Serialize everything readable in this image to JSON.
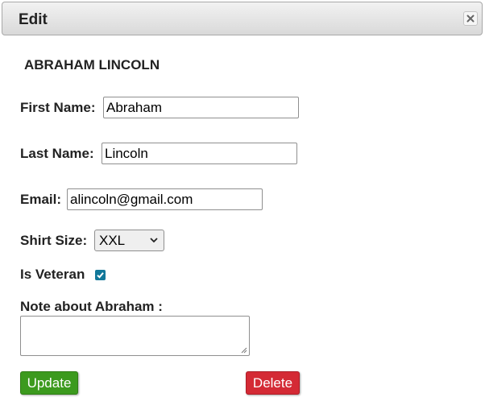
{
  "dialog": {
    "title": "Edit",
    "close_icon": "close-icon"
  },
  "person": {
    "heading": "ABRAHAM LINCOLN"
  },
  "form": {
    "first_name_label": "First Name:",
    "first_name_value": "Abraham",
    "last_name_label": "Last Name:",
    "last_name_value": "Lincoln",
    "email_label": "Email:",
    "email_value": "alincoln@gmail.com",
    "shirt_size_label": "Shirt Size:",
    "shirt_size_value": "XXL",
    "veteran_label": "Is Veteran",
    "veteran_checked": true,
    "note_label": "Note about Abraham :",
    "note_value": ""
  },
  "actions": {
    "update_label": "Update",
    "delete_label": "Delete"
  },
  "colors": {
    "update_button": "#3c9a1e",
    "delete_button": "#d42a35",
    "checkbox_accent": "#12789a"
  }
}
